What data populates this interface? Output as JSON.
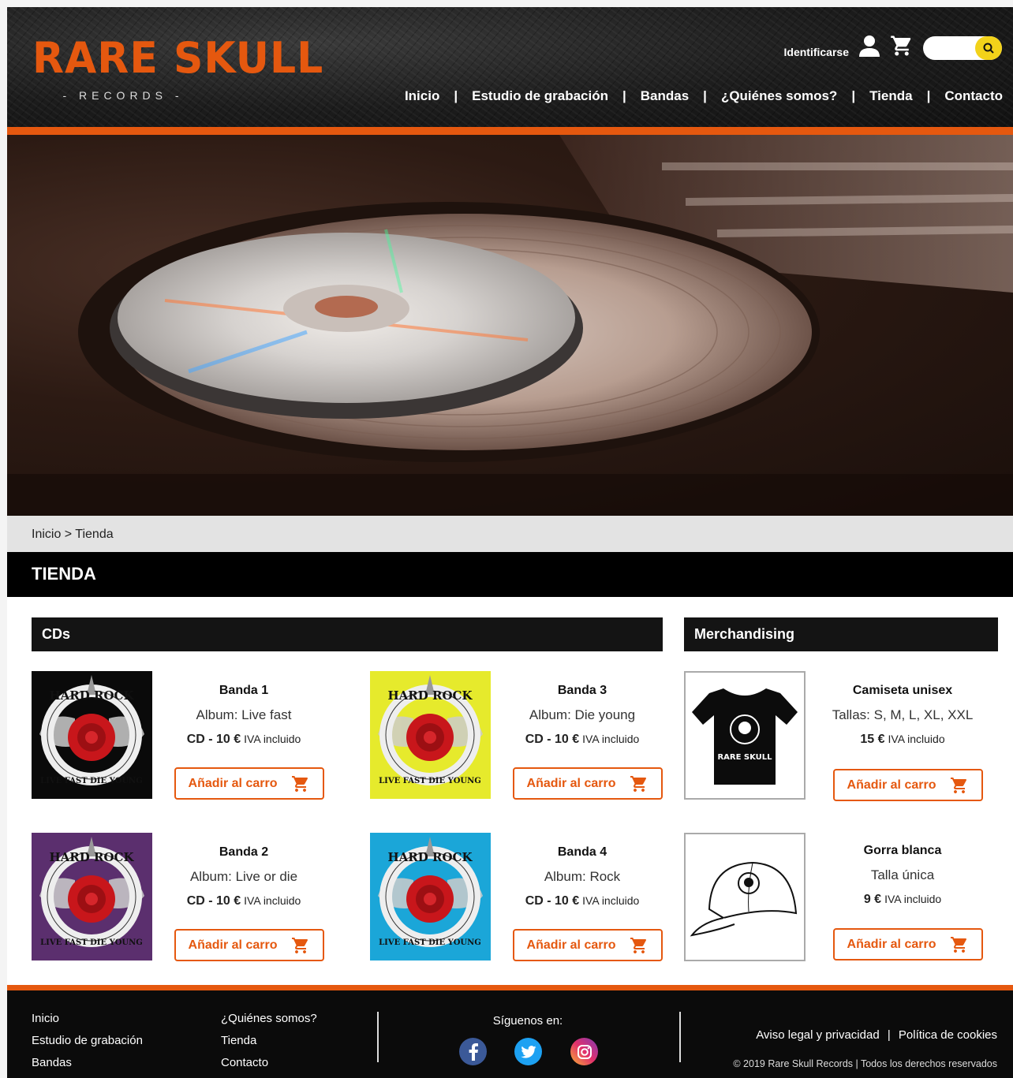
{
  "brand": {
    "name": "RARE SKULL",
    "sub": "- RECORDS -",
    "accent": "#e5580f"
  },
  "header": {
    "login_label": "Identificarse",
    "user_icon": "user-icon",
    "cart_icon": "cart-icon",
    "search_icon": "search-icon",
    "search_placeholder": ""
  },
  "nav": {
    "items": [
      "Inicio",
      "Estudio de grabación",
      "Bandas",
      "¿Quiénes somos?",
      "Tienda",
      "Contacto"
    ],
    "separator": "|"
  },
  "breadcrumb": {
    "text": "Inicio > Tienda"
  },
  "page_title": "TIENDA",
  "sections": {
    "cds": "CDs",
    "merch": "Merchandising"
  },
  "products": [
    {
      "name": "Banda 1",
      "sub": "Album: Live fast",
      "price": "CD - 10 €",
      "tax": "IVA incluido",
      "button": "Añadir al carro",
      "cover_bg": "#0a0a0a"
    },
    {
      "name": "Banda 3",
      "sub": "Album: Die young",
      "price": "CD - 10 €",
      "tax": "IVA incluido",
      "button": "Añadir al carro",
      "cover_bg": "#e6ea2c"
    },
    {
      "name": "Camiseta unisex",
      "sub": "Tallas: S, M, L, XL, XXL",
      "price": "15 €",
      "tax": "IVA incluido",
      "button": "Añadir al carro"
    },
    {
      "name": "Banda 2",
      "sub": "Album: Live or die",
      "price": "CD - 10 €",
      "tax": "IVA incluido",
      "button": "Añadir al carro",
      "cover_bg": "#5b2f6e"
    },
    {
      "name": "Banda 4",
      "sub": "Album: Rock",
      "price": "CD - 10 €",
      "tax": "IVA incluido",
      "button": "Añadir al carro",
      "cover_bg": "#1ba6d8"
    },
    {
      "name": "Gorra blanca",
      "sub": "Talla única",
      "price": "9 €",
      "tax": "IVA incluido",
      "button": "Añadir al carro"
    }
  ],
  "cover_text": {
    "top": "HARD ROCK",
    "bottom": "LIVE FAST DIE YOUNG"
  },
  "shirt_text": "RARE SKULL",
  "footer": {
    "col1": [
      "Inicio",
      "Estudio de grabación",
      "Bandas"
    ],
    "col2": [
      "¿Quiénes somos?",
      "Tienda",
      "Contacto"
    ],
    "follow": "Síguenos en:",
    "social": [
      "facebook-icon",
      "twitter-icon",
      "instagram-icon"
    ],
    "legal": "Aviso legal y privacidad",
    "legal_sep": "|",
    "cookies": "Política de cookies",
    "copyright": "© 2019 Rare Skull Records | Todos los derechos reservados"
  }
}
